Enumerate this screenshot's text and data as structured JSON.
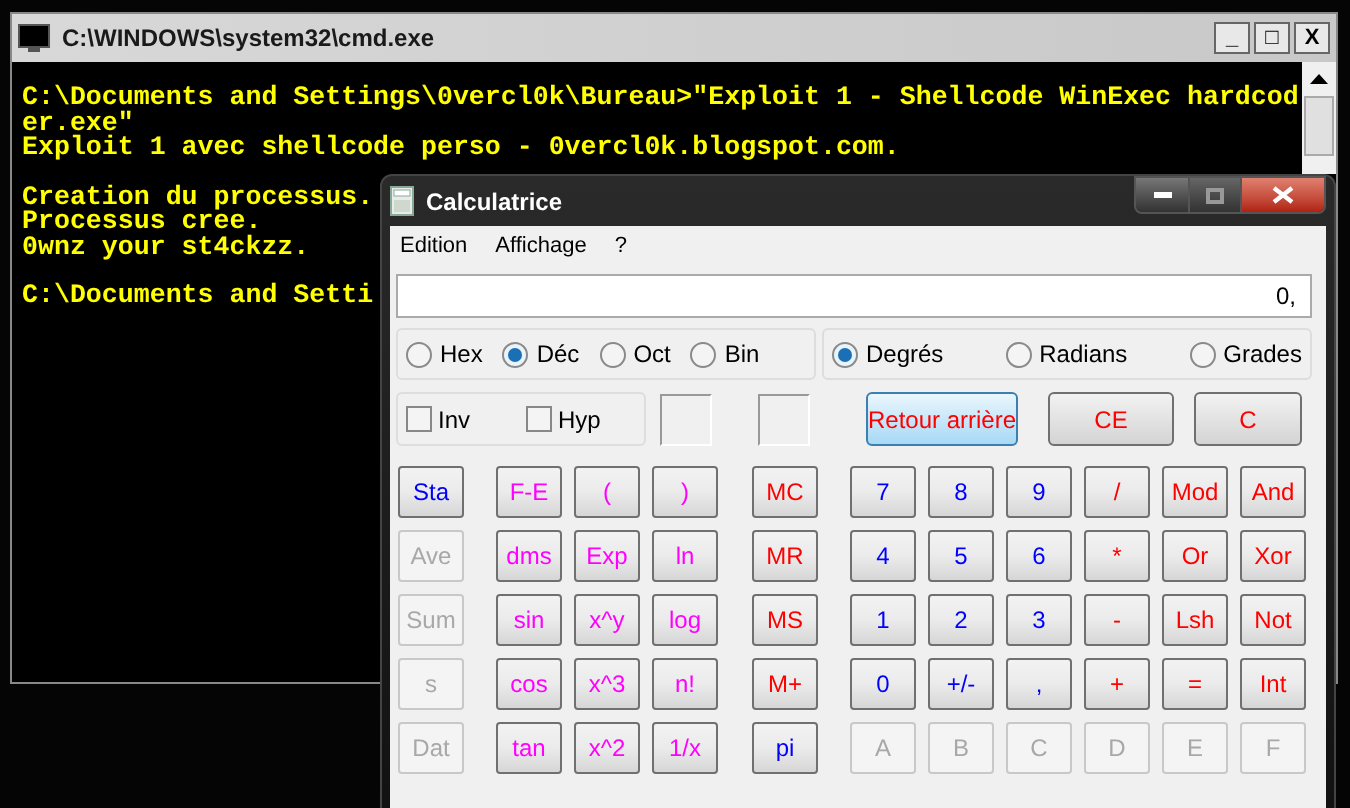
{
  "console_window": {
    "title": "C:\\WINDOWS\\system32\\cmd.exe",
    "controls": [
      "_",
      "□",
      "X"
    ],
    "blocks": [
      [
        "C:\\Documents and Settings\\0vercl0k\\Bureau>\"Exploit 1 - Shellcode WinExec hardcod",
        "er.exe\"",
        "Exploit 1 avec shellcode perso - 0vercl0k.blogspot.com."
      ],
      [
        "Creation du processus.",
        "Processus cree.",
        "0wnz your st4ckzz."
      ],
      [
        "C:\\Documents and Setti"
      ]
    ]
  },
  "calculator": {
    "title": "Calculatrice",
    "menu": [
      "Edition",
      "Affichage",
      "?"
    ],
    "display": "0,",
    "bases": [
      {
        "label": "Hex",
        "selected": false
      },
      {
        "label": "Déc",
        "selected": true
      },
      {
        "label": "Oct",
        "selected": false
      },
      {
        "label": "Bin",
        "selected": false
      }
    ],
    "angles": [
      {
        "label": "Degrés",
        "selected": true
      },
      {
        "label": "Radians",
        "selected": false
      },
      {
        "label": "Grades",
        "selected": false
      }
    ],
    "toggles": [
      {
        "label": "Inv",
        "checked": false
      },
      {
        "label": "Hyp",
        "checked": false
      }
    ],
    "edit_buttons": [
      {
        "label": "Retour arrière",
        "highlighted": true
      },
      {
        "label": "CE",
        "highlighted": false
      },
      {
        "label": "C",
        "highlighted": false
      }
    ],
    "keys": [
      [
        {
          "label": "Sta",
          "color": "#0000ff",
          "disabled": false
        },
        {
          "label": "F-E",
          "color": "#ff00ff",
          "disabled": false
        },
        {
          "label": "(",
          "color": "#ff00ff",
          "disabled": false
        },
        {
          "label": ")",
          "color": "#ff00ff",
          "disabled": false
        },
        {
          "label": "MC",
          "color": "#ff0000",
          "disabled": false
        },
        {
          "label": "7",
          "color": "#0000ff",
          "disabled": false
        },
        {
          "label": "8",
          "color": "#0000ff",
          "disabled": false
        },
        {
          "label": "9",
          "color": "#0000ff",
          "disabled": false
        },
        {
          "label": "/",
          "color": "#ff0000",
          "disabled": false
        },
        {
          "label": "Mod",
          "color": "#ff0000",
          "disabled": false
        },
        {
          "label": "And",
          "color": "#ff0000",
          "disabled": false
        }
      ],
      [
        {
          "label": "Ave",
          "disabled": true
        },
        {
          "label": "dms",
          "color": "#ff00ff",
          "disabled": false
        },
        {
          "label": "Exp",
          "color": "#ff00ff",
          "disabled": false
        },
        {
          "label": "ln",
          "color": "#ff00ff",
          "disabled": false
        },
        {
          "label": "MR",
          "color": "#ff0000",
          "disabled": false
        },
        {
          "label": "4",
          "color": "#0000ff",
          "disabled": false
        },
        {
          "label": "5",
          "color": "#0000ff",
          "disabled": false
        },
        {
          "label": "6",
          "color": "#0000ff",
          "disabled": false
        },
        {
          "label": "*",
          "color": "#ff0000",
          "disabled": false
        },
        {
          "label": "Or",
          "color": "#ff0000",
          "disabled": false
        },
        {
          "label": "Xor",
          "color": "#ff0000",
          "disabled": false
        }
      ],
      [
        {
          "label": "Sum",
          "disabled": true
        },
        {
          "label": "sin",
          "color": "#ff00ff",
          "disabled": false
        },
        {
          "label": "x^y",
          "color": "#ff00ff",
          "disabled": false
        },
        {
          "label": "log",
          "color": "#ff00ff",
          "disabled": false
        },
        {
          "label": "MS",
          "color": "#ff0000",
          "disabled": false
        },
        {
          "label": "1",
          "color": "#0000ff",
          "disabled": false
        },
        {
          "label": "2",
          "color": "#0000ff",
          "disabled": false
        },
        {
          "label": "3",
          "color": "#0000ff",
          "disabled": false
        },
        {
          "label": "-",
          "color": "#ff0000",
          "disabled": false
        },
        {
          "label": "Lsh",
          "color": "#ff0000",
          "disabled": false
        },
        {
          "label": "Not",
          "color": "#ff0000",
          "disabled": false
        }
      ],
      [
        {
          "label": "s",
          "disabled": true
        },
        {
          "label": "cos",
          "color": "#ff00ff",
          "disabled": false
        },
        {
          "label": "x^3",
          "color": "#ff00ff",
          "disabled": false
        },
        {
          "label": "n!",
          "color": "#ff00ff",
          "disabled": false
        },
        {
          "label": "M+",
          "color": "#ff0000",
          "disabled": false
        },
        {
          "label": "0",
          "color": "#0000ff",
          "disabled": false
        },
        {
          "label": "+/-",
          "color": "#0000ff",
          "disabled": false
        },
        {
          "label": ",",
          "color": "#0000ff",
          "disabled": false
        },
        {
          "label": "+",
          "color": "#ff0000",
          "disabled": false
        },
        {
          "label": "=",
          "color": "#ff0000",
          "disabled": false
        },
        {
          "label": "Int",
          "color": "#ff0000",
          "disabled": false
        }
      ],
      [
        {
          "label": "Dat",
          "disabled": true
        },
        {
          "label": "tan",
          "color": "#ff00ff",
          "disabled": false
        },
        {
          "label": "x^2",
          "color": "#ff00ff",
          "disabled": false
        },
        {
          "label": "1/x",
          "color": "#ff00ff",
          "disabled": false
        },
        {
          "label": "pi",
          "color": "#0000ff",
          "disabled": false
        },
        {
          "label": "A",
          "disabled": true
        },
        {
          "label": "B",
          "disabled": true
        },
        {
          "label": "C",
          "disabled": true
        },
        {
          "label": "D",
          "disabled": true
        },
        {
          "label": "E",
          "disabled": true
        },
        {
          "label": "F",
          "disabled": true
        }
      ]
    ]
  }
}
